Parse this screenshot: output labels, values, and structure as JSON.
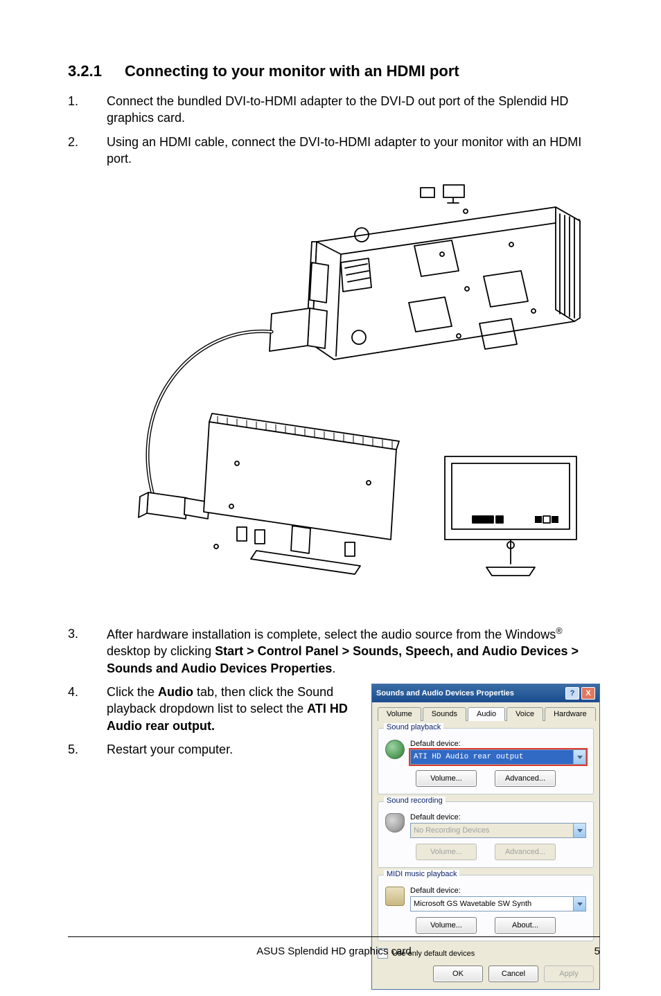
{
  "heading": {
    "number": "3.2.1",
    "title": "Connecting to your monitor with an HDMI port"
  },
  "steps": {
    "s1_n": "1.",
    "s1_txt": "Connect the bundled DVI-to-HDMI adapter to the DVI-D out port of the Splendid HD graphics card.",
    "s2_n": "2.",
    "s2_txt": "Using an HDMI cable, connect the DVI-to-HDMI adapter to your monitor with an HDMI port.",
    "s3_n": "3.",
    "s3_pre": "After hardware installation is complete, select the audio source from the Windows",
    "s3_sup": "®",
    "s3_mid": " desktop by clicking ",
    "s3_b1": "Start > Control Panel > Sounds, Speech, and Audio Devices > Sounds and Audio Devices Properties",
    "s3_post": ".",
    "s4_n": "4.",
    "s4_a": "Click the ",
    "s4_b1": "Audio",
    "s4_b": " tab, then click the Sound playback dropdown list to select the ",
    "s4_b2": "ATI HD Audio rear output.",
    "s5_n": "5.",
    "s5_txt": "Restart your computer."
  },
  "dialog": {
    "title": "Sounds and Audio Devices Properties",
    "help": "?",
    "close": "X",
    "tabs": {
      "volume": "Volume",
      "sounds": "Sounds",
      "audio": "Audio",
      "voice": "Voice",
      "hardware": "Hardware"
    },
    "group_playback": "Sound playback",
    "group_recording": "Sound recording",
    "group_midi": "MIDI music playback",
    "default_device": "Default device:",
    "playback_value": "ATI HD Audio rear output",
    "recording_value": "No Recording Devices",
    "midi_value": "Microsoft GS Wavetable SW Synth",
    "btn_volume": "Volume...",
    "btn_advanced": "Advanced...",
    "btn_about": "About...",
    "chk_label": "Use only default devices",
    "btn_ok": "OK",
    "btn_cancel": "Cancel",
    "btn_apply": "Apply"
  },
  "footer": {
    "center": "ASUS Splendid HD graphics card",
    "page": "5"
  }
}
